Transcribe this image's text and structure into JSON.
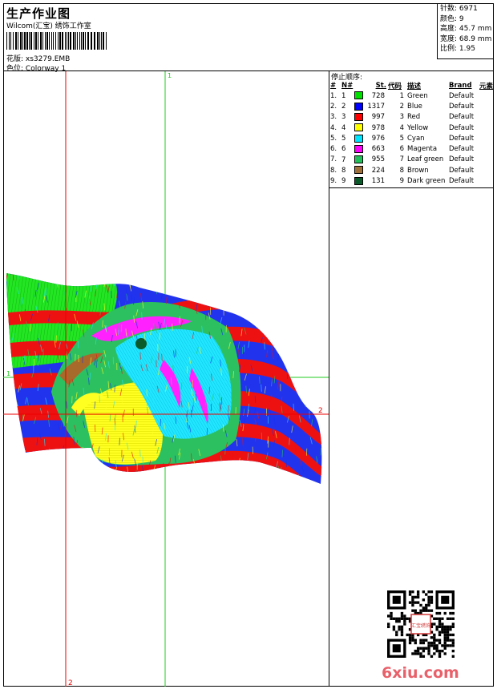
{
  "header": {
    "title": "生产作业图",
    "company": "Wilcom(汇宝) 绣饰工作室",
    "design_label": "花版:",
    "design_file": "xs3279.EMB",
    "colorway_label": "色位:",
    "colorway": "Colorway 1"
  },
  "stats": [
    {
      "label": "针数:",
      "value": "6971"
    },
    {
      "label": "颜色:",
      "value": "9"
    },
    {
      "label": "高度:",
      "value": "45.7 mm"
    },
    {
      "label": "宽度:",
      "value": "68.9 mm"
    },
    {
      "label": "比例:",
      "value": "1.95"
    }
  ],
  "thread_table": {
    "title": "停止顺序:",
    "columns": [
      "#",
      "N#",
      "St.",
      "代码",
      "描述",
      "Brand",
      "元素"
    ],
    "rows": [
      {
        "num": "1.",
        "n": "1",
        "color": "#00e000",
        "st": "728",
        "code": "1",
        "desc": "Green",
        "brand": "Default"
      },
      {
        "num": "2.",
        "n": "2",
        "color": "#0000ff",
        "st": "1317",
        "code": "2",
        "desc": "Blue",
        "brand": "Default"
      },
      {
        "num": "3.",
        "n": "3",
        "color": "#ff0000",
        "st": "997",
        "code": "3",
        "desc": "Red",
        "brand": "Default"
      },
      {
        "num": "4.",
        "n": "4",
        "color": "#ffff00",
        "st": "978",
        "code": "4",
        "desc": "Yellow",
        "brand": "Default"
      },
      {
        "num": "5.",
        "n": "5",
        "color": "#00e5ff",
        "st": "976",
        "code": "5",
        "desc": "Cyan",
        "brand": "Default"
      },
      {
        "num": "6.",
        "n": "6",
        "color": "#ff00ff",
        "st": "663",
        "code": "6",
        "desc": "Magenta",
        "brand": "Default"
      },
      {
        "num": "7.",
        "n": "7",
        "color": "#22c05a",
        "st": "955",
        "code": "7",
        "desc": "Leaf green",
        "brand": "Default"
      },
      {
        "num": "8.",
        "n": "8",
        "color": "#a0703a",
        "st": "224",
        "code": "8",
        "desc": "Brown",
        "brand": "Default"
      },
      {
        "num": "9.",
        "n": "9",
        "color": "#0a5a2a",
        "st": "131",
        "code": "9",
        "desc": "Dark green",
        "brand": "Default"
      }
    ]
  },
  "guides": {
    "v_green": "1",
    "h_green": "1",
    "h_red": "2",
    "v_red": "2"
  },
  "watermark": "6xiu.com",
  "qr_stamp": "汇宝绣饰"
}
